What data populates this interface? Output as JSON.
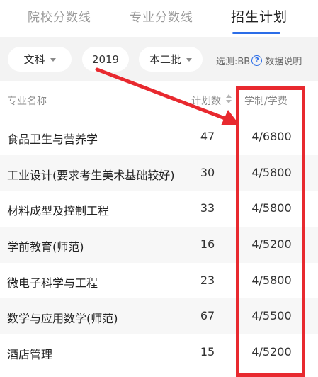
{
  "tabs": [
    {
      "label": "院校分数线",
      "active": false
    },
    {
      "label": "专业分数线",
      "active": false
    },
    {
      "label": "招生计划",
      "active": true
    }
  ],
  "filters": {
    "subject": "文科",
    "year": "2019",
    "batch": "本二批",
    "select_note": "选测:BB",
    "help_label": "数据说明"
  },
  "table": {
    "columns": [
      "专业名称",
      "计划数",
      "学制/学费"
    ],
    "rows": [
      {
        "major": "食品卫生与营养学",
        "plan": "47",
        "fee": "4/6800"
      },
      {
        "major": "工业设计(要求考生美术基础较好)",
        "plan": "30",
        "fee": "4/5800"
      },
      {
        "major": "材料成型及控制工程",
        "plan": "33",
        "fee": "4/5800"
      },
      {
        "major": "学前教育(师范)",
        "plan": "16",
        "fee": "4/5200"
      },
      {
        "major": "微电子科学与工程",
        "plan": "23",
        "fee": "4/5800"
      },
      {
        "major": "数学与应用数学(师范)",
        "plan": "67",
        "fee": "4/5500"
      },
      {
        "major": "酒店管理",
        "plan": "15",
        "fee": "4/5200"
      }
    ]
  },
  "colors": {
    "accent": "#2b6de8",
    "annotation": "#e8292f"
  },
  "icons": [
    "caret-down-icon",
    "help-circle-icon",
    "sort-icon",
    "annotation-arrow"
  ]
}
